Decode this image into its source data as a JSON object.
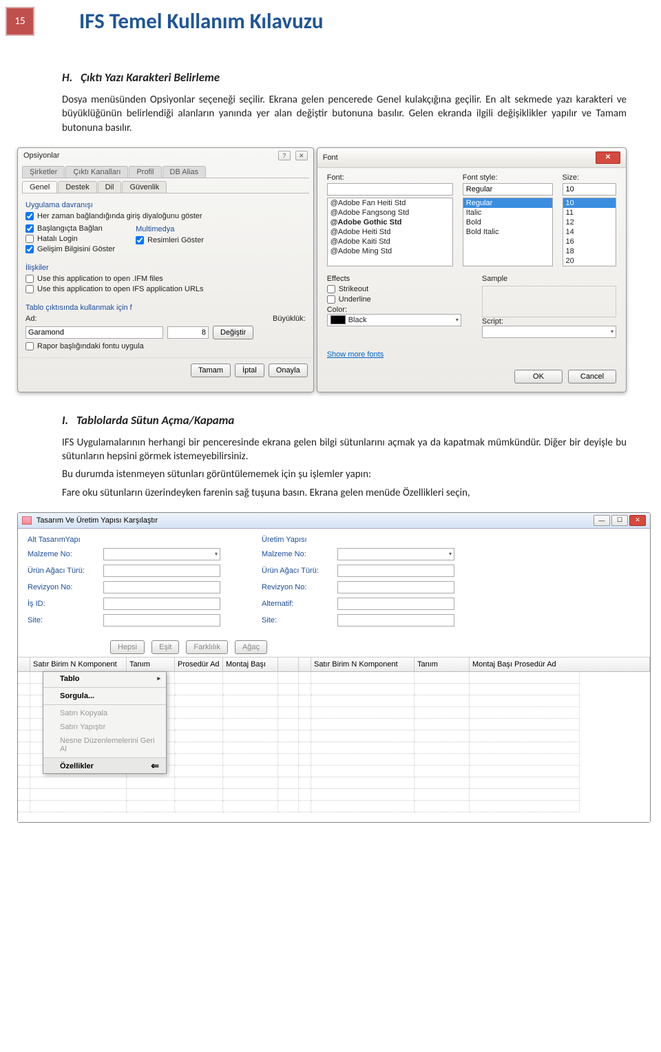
{
  "page_number": "15",
  "doc_title": "IFS Temel Kullanım Kılavuzu",
  "sectionH": {
    "idx": "H.",
    "title": "Çıktı Yazı Karakteri Belirleme",
    "p": "Dosya menüsünden Opsiyonlar seçeneği seçilir. Ekrana gelen pencerede Genel kulakçığına geçilir. En alt sekmede yazı karakteri ve büyüklüğünün belirlendiği alanların yanında yer alan değiştir butonuna basılır. Gelen ekranda ilgili değişiklikler yapılır ve Tamam butonuna basılır."
  },
  "opsiyon": {
    "title": "Opsiyonlar",
    "tabs_back": [
      "Şirketler",
      "Çıktı Kanalları",
      "Profil",
      "DB Alias"
    ],
    "tabs_front": [
      "Genel",
      "Destek",
      "Dil",
      "Güvenlik"
    ],
    "grp1": "Uygulama davranışı",
    "chk1": "Her zaman bağlandığında giriş diyaloğunu göster",
    "chk2": "Başlangıçta Bağlan",
    "chk3": "Hatalı Login",
    "chk4": "Gelişim Bilgisini Göster",
    "mm_label": "Multimedya",
    "mm_chk": "Resimleri Göster",
    "grp2": "İlişkiler",
    "chk5": "Use this application to open .IFM files",
    "chk6": "Use this application to open IFS application URLs",
    "grp3": "Tablo çıktısında kullanmak için f",
    "ad_label": "Ad:",
    "ad_value": "Garamond",
    "size_label": "Büyüklük:",
    "size_value": "8",
    "degistir": "Değiştir",
    "chk7": "Rapor başlığındaki fontu uygula",
    "b_tamam": "Tamam",
    "b_iptal": "İptal",
    "b_onayla": "Onayla"
  },
  "font": {
    "title": "Font",
    "font_label": "Font:",
    "font_sel": "",
    "fonts": [
      "@Adobe Fan Heiti Std",
      "@Adobe Fangsong Std",
      "@Adobe Gothic Std",
      "@Adobe Heiti Std",
      "@Adobe Kaiti Std",
      "@Adobe Ming Std"
    ],
    "style_label": "Font style:",
    "style_sel": "Regular",
    "styles": [
      "Regular",
      "Italic",
      "Bold",
      "Bold Italic"
    ],
    "size_label": "Size:",
    "size_sel": "10",
    "sizes": [
      "10",
      "11",
      "12",
      "14",
      "16",
      "18",
      "20"
    ],
    "effects_label": "Effects",
    "strike": "Strikeout",
    "underline": "Underline",
    "color_label": "Color:",
    "color": "Black",
    "sample_label": "Sample",
    "script_label": "Script:",
    "more": "Show more fonts",
    "ok": "OK",
    "cancel": "Cancel"
  },
  "sectionI": {
    "idx": "I.",
    "title": "Tablolarda Sütun Açma/Kapama",
    "p1": "IFS Uygulamalarının herhangi bir penceresinde ekrana gelen bilgi sütunlarını açmak ya da kapatmak mümkündür. Diğer bir deyişle bu sütunların hepsini görmek istemeyebilirsiniz.",
    "p2a": "Bu durumda istenmeyen sütunları görüntülememek için şu işlemler yapın:",
    "p2b": "Fare oku sütunların üzerindeyken farenin sağ tuşuna basın. Ekrana gelen menüde Özellikleri seçin,"
  },
  "ifs": {
    "title": "Tasarım Ve Üretim Yapısı Karşılaştır",
    "leftcol": "Alt TasarımYapı",
    "rightcol": "Üretim Yapısı",
    "malzeme": "Malzeme No:",
    "urun": "Ürün Ağacı Türü:",
    "rev": "Revizyon No:",
    "isid": "İş ID:",
    "alt": "Alternatif:",
    "site": "Site:",
    "b_hepsi": "Hepsi",
    "b_esit": "Eşit",
    "b_fark": "Farklılık",
    "b_agac": "Ağaç",
    "ghdr_left": [
      "Satır Birim N Komponent",
      "Tanım",
      "Prosedür Ad",
      "Montaj Başı"
    ],
    "ghdr_right": [
      "Satır Birim N Komponent",
      "Tanım",
      "Montaj Başı Prosedür Ad"
    ],
    "ctx": {
      "tablo": "Tablo",
      "sorgula": "Sorgula...",
      "kopyala": "Satırı Kopyala",
      "yapistir": "Satırı Yapıştır",
      "gerial": "Nesne Düzenlemelerini Geri Al",
      "ozellik": "Özellikler"
    }
  }
}
